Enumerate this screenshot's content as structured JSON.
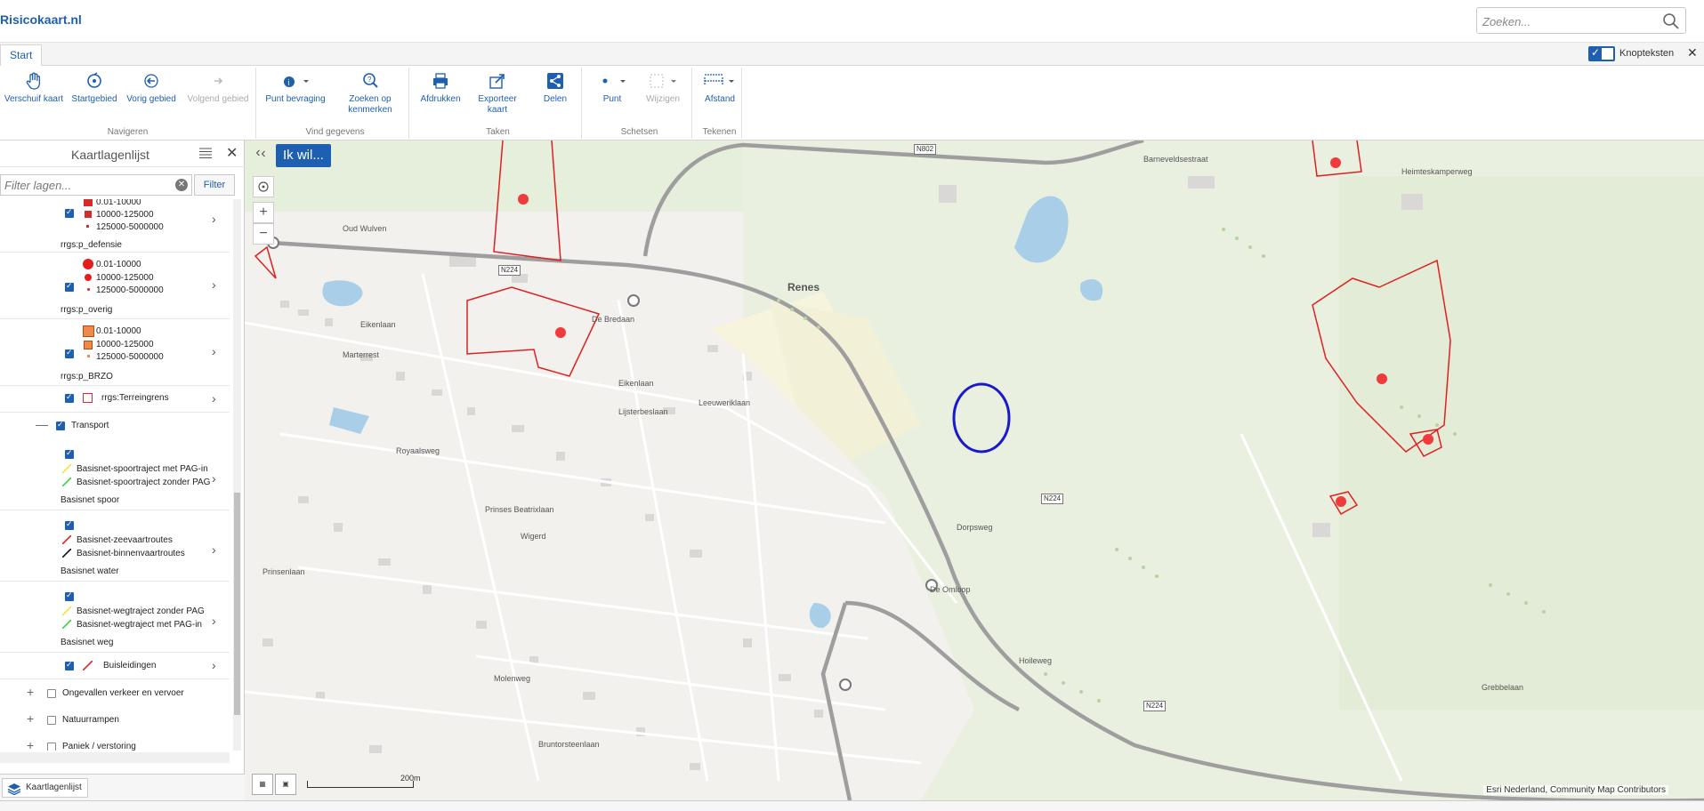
{
  "app": {
    "title": "Risicokaart.nl"
  },
  "search": {
    "placeholder": "Zoeken..."
  },
  "ribbon": {
    "tab": "Start",
    "knopteksten_label": "Knopteksten",
    "groups": {
      "navigeren": "Navigeren",
      "vind": "Vind gegevens",
      "taken": "Taken",
      "schetsen": "Schetsen",
      "tekenen": "Tekenen"
    },
    "buttons": {
      "verschuif": "Verschuif kaart",
      "startgebied": "Startgebied",
      "vorig": "Vorig gebied",
      "volgend": "Volgend gebied",
      "punt_bevraging": "Punt bevraging",
      "zoeken_kenmerken": "Zoeken op kenmerken",
      "afdrukken": "Afdrukken",
      "exporteer": "Exporteer kaart",
      "delen": "Delen",
      "punt": "Punt",
      "wijzigen": "Wijzigen",
      "afstand": "Afstand"
    }
  },
  "panel": {
    "title": "Kaartlagenlijst",
    "filter_placeholder": "Filter lagen...",
    "filter_button": "Filter",
    "layers": {
      "defensie": {
        "legend": [
          "0.01-10000",
          "10000-125000",
          "125000-5000000"
        ],
        "name": "rrgs:p_defensie"
      },
      "overig": {
        "legend": [
          "0.01-10000",
          "10000-125000",
          "125000-5000000"
        ],
        "name": "rrgs:p_overig"
      },
      "brzo": {
        "legend": [
          "0.01-10000",
          "10000-125000",
          "125000-5000000"
        ],
        "name": "rrgs:p_BRZO"
      },
      "terreingrens": "rrgs:Terreingrens",
      "transport": "Transport",
      "spoor": {
        "legend": [
          "Basisnet-spoortraject met PAG-in",
          "Basisnet-spoortraject zonder PAG"
        ],
        "name": "Basisnet spoor"
      },
      "water": {
        "legend": [
          "Basisnet-zeevaartroutes",
          "Basisnet-binnenvaartroutes"
        ],
        "name": "Basisnet water"
      },
      "weg": {
        "legend": [
          "Basisnet-wegtraject zonder PAG",
          "Basisnet-wegtraject met PAG-in"
        ],
        "name": "Basisnet weg"
      },
      "buisleidingen": "Buisleidingen",
      "ongevallen": "Ongevallen verkeer en vervoer",
      "natuurrampen": "Natuurrampen",
      "paniek": "Paniek / verstoring"
    },
    "bottom_tab": "Kaartlagenlijst"
  },
  "map": {
    "ik_wil": "Ik wil...",
    "labels": {
      "renes": "Renes",
      "oud_wulven": "Oud Wulven",
      "barneveldsestraat": "Barneveldsestraat",
      "heimteskamperweg": "Heimteskamperweg",
      "eikenlaan": "Eikenlaan",
      "eikenlaan2": "Eikenlaan",
      "prinses_beatrixlaan": "Prinses Beatrixlaan",
      "lijsterbeslaan": "Lijsterbeslaan",
      "leeuweriklaan": "Leeuweriklaan",
      "wigerd": "Wigerd",
      "hoileweg": "Hoileweg",
      "molenweg": "Molenweg",
      "bruntorsteenlaan": "Bruntorsteenlaan",
      "de_omloop": "De Omloop",
      "dorpsweg": "Dorpsweg",
      "royaalsweg": "Royaalsweg",
      "marterrest": "Marterrest",
      "de_bredaan": "De Bredaan",
      "prinsenlaan": "Prinsenlaan",
      "grebbelaan": "Grebbelaan"
    },
    "road_signs": {
      "n802": "N802",
      "n224_a": "N224",
      "n224_b": "N224",
      "n224_c": "N224"
    },
    "scale_label": "200m",
    "attribution": "Esri Nederland, Community Map Contributors"
  }
}
